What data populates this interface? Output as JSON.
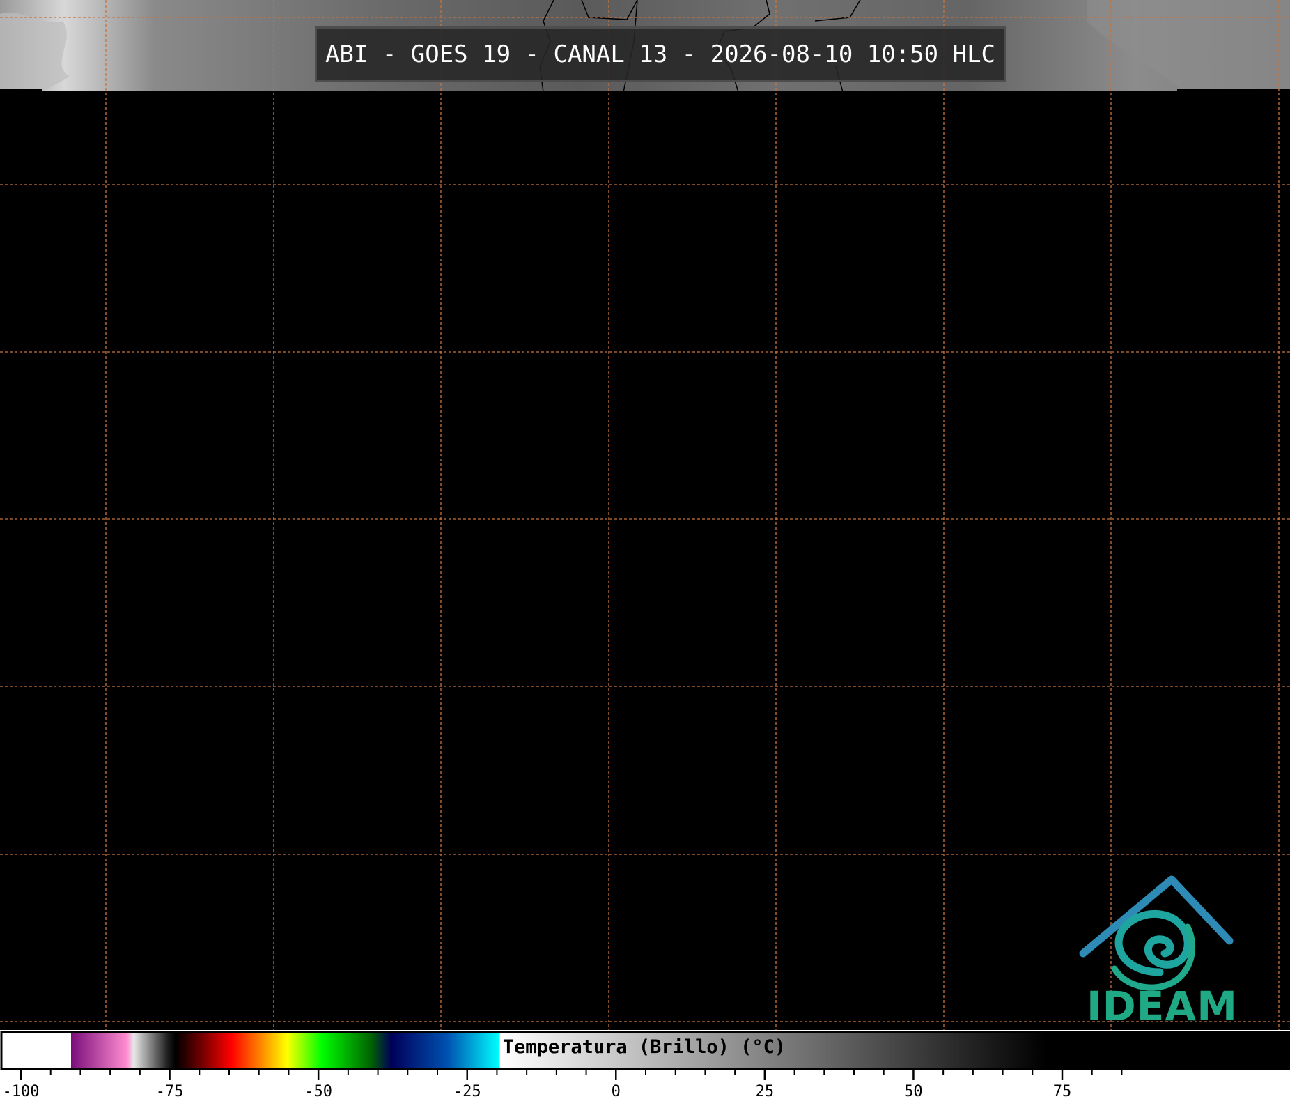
{
  "title": "ABI - GOES 19 - CANAL 13 - 2026-08-10 10:50 HLC",
  "colorbar": {
    "label": "Temperatura (Brillo) (°C)",
    "min": -100,
    "max": 85,
    "tick_labels": [
      "-100",
      "-75",
      "-50",
      "-25",
      "0",
      "25",
      "50",
      "75"
    ],
    "major_ticks": [
      -100,
      -75,
      -50,
      -25,
      0,
      25,
      50,
      75
    ],
    "minor_step": 5,
    "stops": [
      {
        "v": -100,
        "c": "#ffffff"
      },
      {
        "v": -90.01,
        "c": "#ffffff"
      },
      {
        "v": -90,
        "c": "#7a0e7a"
      },
      {
        "v": -82,
        "c": "#ff8cd0"
      },
      {
        "v": -81,
        "c": "#e8e8e8"
      },
      {
        "v": -76,
        "c": "#1a1a1a"
      },
      {
        "v": -75,
        "c": "#000000"
      },
      {
        "v": -71,
        "c": "#7a0000"
      },
      {
        "v": -67,
        "c": "#ff0000"
      },
      {
        "v": -63,
        "c": "#ff7f00"
      },
      {
        "v": -59,
        "c": "#ffff00"
      },
      {
        "v": -54,
        "c": "#00ff00"
      },
      {
        "v": -47,
        "c": "#006400"
      },
      {
        "v": -44,
        "c": "#00005a"
      },
      {
        "v": -36,
        "c": "#0050b0"
      },
      {
        "v": -28.5,
        "c": "#00ffff"
      },
      {
        "v": -28.4,
        "c": "#ffffff"
      },
      {
        "v": 50,
        "c": "#000000"
      },
      {
        "v": 85,
        "c": "#000000"
      }
    ]
  },
  "logo": {
    "text": "IDEAM"
  },
  "colors": {
    "grid": "#c8733c",
    "background": "#000000"
  }
}
